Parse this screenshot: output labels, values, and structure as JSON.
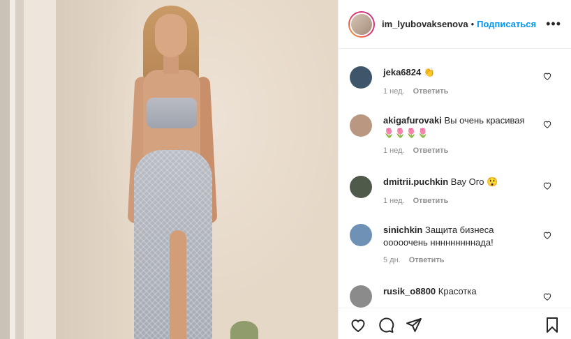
{
  "post": {
    "username": "im_lyubovaksenova",
    "separator": "•",
    "follow_label": "Подписаться",
    "more_label": "•••"
  },
  "comments": [
    {
      "user": "jeka6824",
      "text": "👏",
      "time": "1 нед.",
      "reply": "Ответить",
      "avatar_color": "#3f556a"
    },
    {
      "user": "akigafurovaki",
      "text": "Вы очень красивая 🌷🌷🌷🌷",
      "time": "1 нед.",
      "reply": "Ответить",
      "avatar_color": "#b99780"
    },
    {
      "user": "dmitrii.puchkin",
      "text": "Вау Ого 😲",
      "time": "1 нед.",
      "reply": "Ответить",
      "avatar_color": "#4f5a4b"
    },
    {
      "user": "sinichkin",
      "text": "Защита бизнеса ооооочень нннннннннада!",
      "time": "5 дн.",
      "reply": "Ответить",
      "avatar_color": "#6e91b5"
    },
    {
      "user": "rusik_o8800",
      "text": "Красотка",
      "time": "",
      "reply": "",
      "avatar_color": "#8b8b8b"
    }
  ],
  "icons": {
    "like": "heart-outline-icon",
    "comment": "speech-bubble-icon",
    "share": "paper-plane-icon",
    "save": "bookmark-icon",
    "comment_like": "heart-small-icon"
  }
}
